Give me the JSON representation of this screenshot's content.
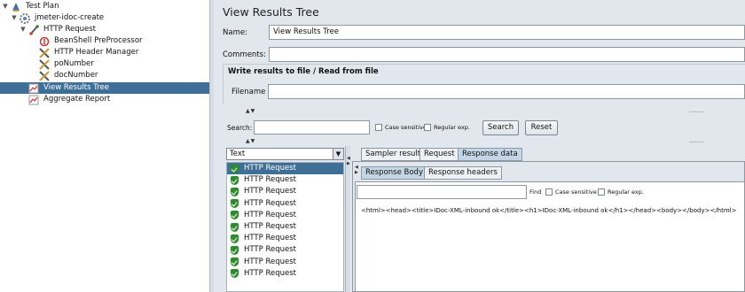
{
  "tree": {
    "items": [
      {
        "label": "Test Plan",
        "toggle": "▼",
        "icon": "test-plan-icon"
      },
      {
        "label": "jmeter-idoc-create",
        "toggle": "▼",
        "icon": "thread-group-icon"
      },
      {
        "label": "HTTP Request",
        "toggle": "▼",
        "icon": "http-request-icon"
      },
      {
        "label": "BeanShell PreProcessor",
        "toggle": "",
        "icon": "beanshell-icon"
      },
      {
        "label": "HTTP Header Manager",
        "toggle": "",
        "icon": "config-tools-icon"
      },
      {
        "label": "poNumber",
        "toggle": "",
        "icon": "config-tools-icon"
      },
      {
        "label": "docNumber",
        "toggle": "",
        "icon": "config-tools-icon"
      },
      {
        "label": "View Results Tree",
        "toggle": "",
        "icon": "listener-chart-icon"
      },
      {
        "label": "Aggregate Report",
        "toggle": "",
        "icon": "listener-chart-icon"
      }
    ]
  },
  "main": {
    "title": "View Results Tree",
    "name_label": "Name:",
    "name_value": "View Results Tree",
    "comments_label": "Comments:",
    "comments_value": "",
    "file_section_title": "Write results to file / Read from file",
    "filename_label": "Filename",
    "filename_value": ""
  },
  "search": {
    "label": "Search:",
    "value": "",
    "case_sensitive_label": "Case sensitive",
    "regex_label": "Regular exp.",
    "search_button": "Search",
    "reset_button": "Reset"
  },
  "renderer": {
    "selected": "Text"
  },
  "samples": {
    "items": [
      "HTTP Request",
      "HTTP Request",
      "HTTP Request",
      "HTTP Request",
      "HTTP Request",
      "HTTP Request",
      "HTTP Request",
      "HTTP Request",
      "HTTP Request",
      "HTTP Request"
    ]
  },
  "tabs": {
    "sampler_result": "Sampler result",
    "request": "Request",
    "response_data": "Response data"
  },
  "inner_tabs": {
    "response_body": "Response Body",
    "response_headers": "Response headers"
  },
  "find": {
    "value": "",
    "find_label": "Find",
    "case_sensitive_label": "Case sensitive",
    "regex_label": "Regular exp."
  },
  "response": {
    "text": "<html><head><title>IDoc-XML-inbound ok</title><h1>IDoc-XML-inbound ok</h1></head><body></body></html>"
  },
  "colors": {
    "selection": "#3f6f96",
    "active_tab": "#c3d6e6",
    "success_green": "#2e8b2e"
  }
}
